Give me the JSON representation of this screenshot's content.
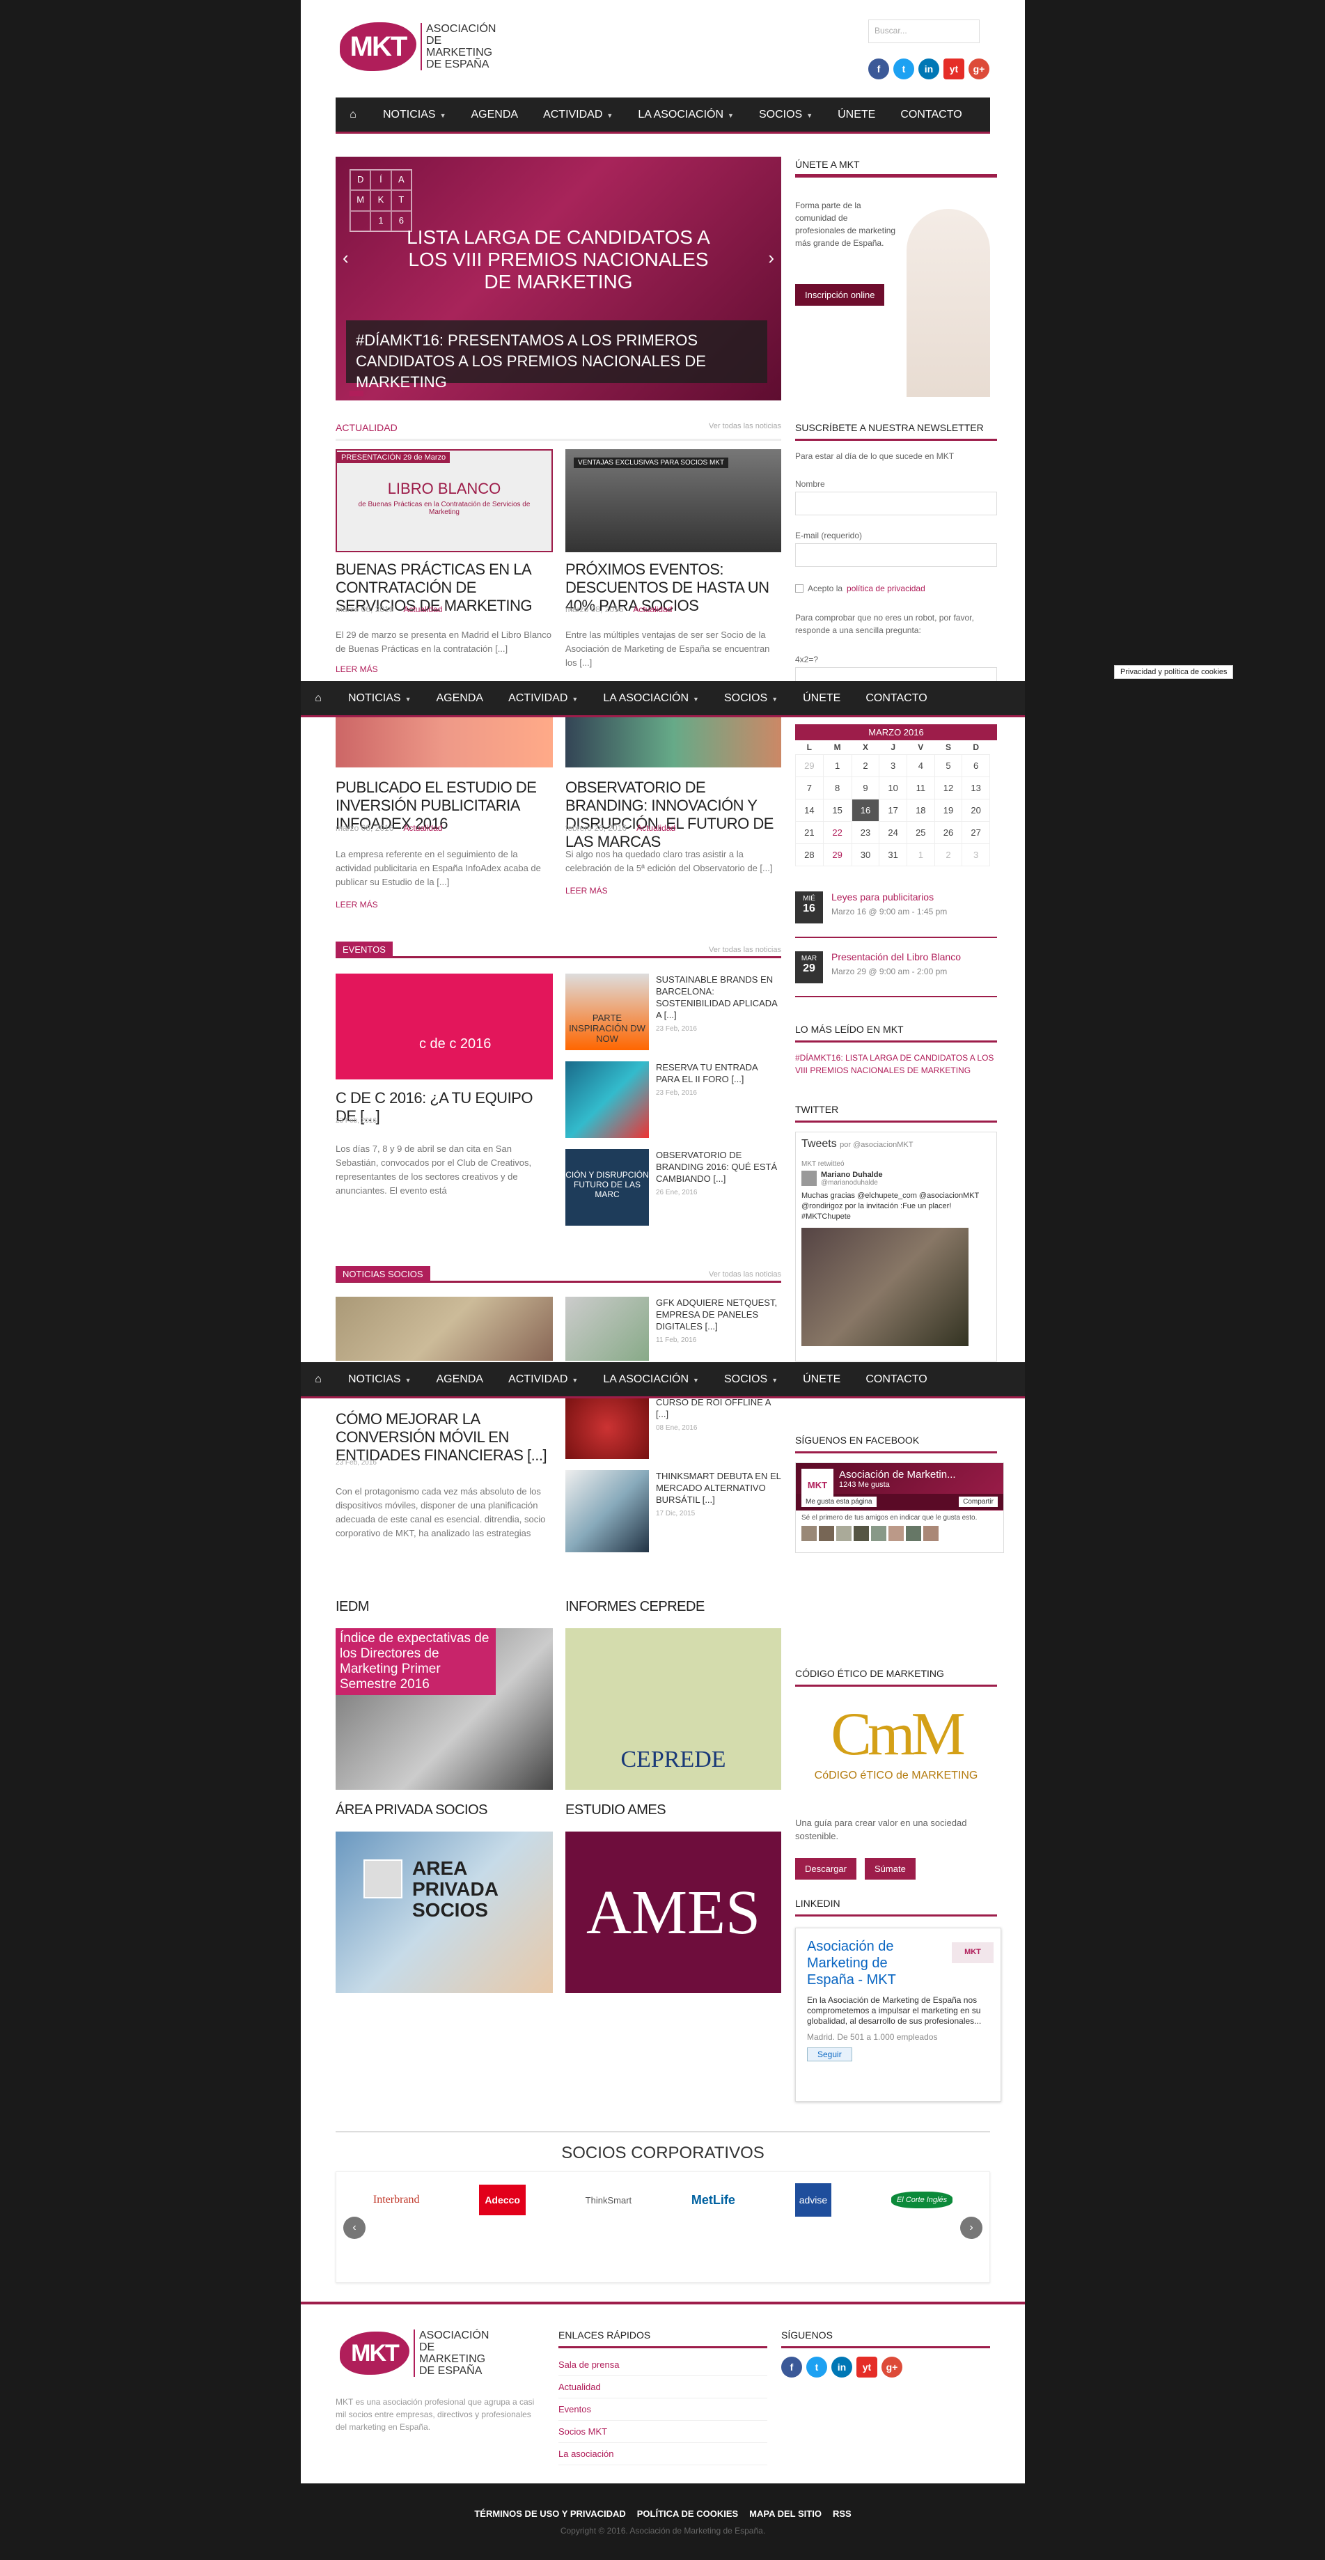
{
  "header": {
    "logo_text": "MKT",
    "logo_sub": "ASOCIACIÓN DE MARKETING DE ESPAÑA",
    "search_placeholder": "Buscar...",
    "social": [
      "f",
      "t",
      "in",
      "yt",
      "g+"
    ]
  },
  "nav": {
    "items": [
      "NOTICIAS",
      "AGENDA",
      "ACTIVIDAD",
      "LA ASOCIACIÓN",
      "SOCIOS",
      "ÚNETE",
      "CONTACTO"
    ]
  },
  "hero": {
    "grid_letters": [
      "D",
      "Í",
      "A",
      "",
      "M",
      "K",
      "T",
      "",
      "1",
      "6"
    ],
    "headline": "LISTA LARGA DE CANDIDATOS A LOS VIII PREMIOS NACIONALES DE MARKETING",
    "caption": "#DÍAMKT16: PRESENTAMOS A LOS PRIMEROS CANDIDATOS A LOS PREMIOS NACIONALES DE MARKETING"
  },
  "join": {
    "title": "ÚNETE A MKT",
    "text": "Forma parte de la comunidad de profesionales de marketing más grande de España.",
    "button": "Inscripción online"
  },
  "actualidad": {
    "title": "ACTUALIDAD",
    "see_all": "Ver todas las noticias",
    "posts": [
      {
        "img_label": "PRESENTACIÓN 29 de Marzo",
        "img_title": "LIBRO BLANCO",
        "img_sub": "de Buenas Prácticas en la Contratación de Servicios de Marketing",
        "title": "BUENAS PRÁCTICAS EN LA CONTRATACIÓN DE SERVICIOS DE MARKETING",
        "date": "marzo 06, 2016",
        "cat": "Actualidad",
        "excerpt": "El 29 de marzo se presenta en Madrid el Libro Blanco de Buenas Prácticas en la contratación [...]",
        "more": "LEER MÁS"
      },
      {
        "img_label": "VENTAJAS EXCLUSIVAS PARA SOCIOS MKT",
        "title": "PRÓXIMOS EVENTOS: DESCUENTOS DE HASTA UN 40% PARA SOCIOS",
        "date": "marzo 08, 2016",
        "cat": "Actualidad",
        "excerpt": "Entre las múltiples ventajas de ser ser Socio de la Asociación de Marketing de España se encuentran los [...]"
      },
      {
        "title": "PUBLICADO EL ESTUDIO DE INVERSIÓN PUBLICITARIA INFOADEX 2016",
        "date": "marzo 08, 2016",
        "cat": "Actualidad",
        "excerpt": "La empresa referente en el seguimiento de la actividad publicitaria en España InfoAdex acaba de publicar su Estudio de la [...]",
        "more": "LEER MÁS"
      },
      {
        "title": "OBSERVATORIO DE BRANDING: INNOVACIÓN Y DISRUPCIÓN, EL FUTURO DE LAS MARCAS",
        "date": "febrero 26, 2016",
        "cat": "Actualidad",
        "excerpt": "Si algo nos ha quedado claro tras asistir a la celebración de la 5ª edición del Observatorio de [...]",
        "more": "LEER MÁS"
      }
    ]
  },
  "newsletter": {
    "title": "SUSCRÍBETE A NUESTRA NEWSLETTER",
    "intro": "Para estar al día de lo que sucede en MKT",
    "name_label": "Nombre",
    "email_label": "E-mail (requerido)",
    "privacy_prefix": "Acepto la",
    "privacy_link": "política de privacidad",
    "robot": "Para comprobar que no eres un robot, por favor, responde a una sencilla pregunta:",
    "question": "4x2=?"
  },
  "privacy_pill": "Privacidad y política de cookies",
  "calendar": {
    "month": "MARZO 2016",
    "days": [
      "L",
      "M",
      "X",
      "J",
      "V",
      "S",
      "D"
    ],
    "rows": [
      [
        "29",
        "1",
        "2",
        "3",
        "4",
        "5",
        "6"
      ],
      [
        "7",
        "8",
        "9",
        "10",
        "11",
        "12",
        "13"
      ],
      [
        "14",
        "15",
        "16",
        "17",
        "18",
        "19",
        "20"
      ],
      [
        "21",
        "22",
        "23",
        "24",
        "25",
        "26",
        "27"
      ],
      [
        "28",
        "29",
        "30",
        "31",
        "1",
        "2",
        "3"
      ]
    ]
  },
  "events": [
    {
      "dow": "MIÉ",
      "day": "16",
      "title": "Leyes para publicitarios",
      "time": "Marzo 16 @ 9:00 am - 1:45 pm"
    },
    {
      "dow": "MAR",
      "day": "29",
      "title": "Presentación del Libro Blanco",
      "time": "Marzo 29 @ 9:00 am - 2:00 pm"
    }
  ],
  "most_read": {
    "title": "LO MÁS LEÍDO EN MKT",
    "link": "#DÍAMKT16: LISTA LARGA DE CANDIDATOS A LOS VIII PREMIOS NACIONALES DE MARKETING"
  },
  "twitter": {
    "title": "TWITTER",
    "tweets_label": "Tweets",
    "by": "por @asociacionMKT",
    "retweeted": "MKT retwitteó",
    "user": "Mariano Duhalde",
    "handle": "@marianoduhalde",
    "text": "Muchas gracias @elchupete_com @asociacionMKT @rondirigoz por la invitación :Fue un placer! #MKTChupete"
  },
  "eventos": {
    "title": "EVENTOS",
    "see_all": "Ver todas las noticias",
    "main_img": "c de c 2016",
    "main_title": "C DE C 2016: ¿A TU EQUIPO DE [...]",
    "main_date": "23 Feb, 2016",
    "main_excerpt": "Los días 7, 8 y 9 de abril se dan cita en San Sebastián, convocados por el Club de Creativos, representantes de los sectores creativos y de anunciantes. El evento está",
    "list": [
      {
        "title": "SUSTAINABLE BRANDS EN BARCELONA: SOSTENIBILIDAD APLICADA A [...]",
        "date": "23 Feb, 2016",
        "img": "PARTE INSPIRACIÓN DW NOW"
      },
      {
        "title": "RESERVA TU ENTRADA PARA EL II FORO [...]",
        "date": "23 Feb, 2016"
      },
      {
        "title": "OBSERVATORIO DE BRANDING 2016: QUÉ ESTÁ CAMBIANDO [...]",
        "date": "26 Ene, 2016",
        "img": "CIÓN Y DISRUPCIÓN FUTURO DE LAS MARC"
      }
    ]
  },
  "noticias_socios": {
    "title": "NOTICIAS SOCIOS",
    "see_all": "Ver todas las noticias",
    "main_title": "CÓMO MEJORAR LA CONVERSIÓN MÓVIL EN ENTIDADES FINANCIERAS [...]",
    "main_date": "23 Feb, 2016",
    "main_excerpt": "Con el protagonismo cada vez más absoluto de los dispositivos móviles, disponer de una planificación adecuada de este canal es esencial. ditrendia, socio corporativo de MKT, ha analizado las estrategias",
    "list": [
      {
        "title": "GFK ADQUIERE NETQUEST, EMPRESA DE PANELES DIGITALES [...]",
        "date": "11 Feb, 2016"
      },
      {
        "title": "CURSO DE ROI OFFLINE A [...]",
        "date": "08 Ene, 2016"
      },
      {
        "title": "THINKSMART DEBUTA EN EL MERCADO ALTERNATIVO BURSÁTIL [...]",
        "date": "17 Dic, 2015"
      }
    ]
  },
  "facebook": {
    "title": "SÍGUENOS EN FACEBOOK",
    "page": "Asociación de Marketin...",
    "likes": "1243 Me gusta",
    "like_btn": "Me gusta esta página",
    "share_btn": "Compartir",
    "friends": "Sé el primero de tus amigos en indicar que le gusta esto."
  },
  "blocks": [
    {
      "title": "IEDM",
      "img": "Índice de expectativas de los Directores de Marketing Primer Semestre 2016"
    },
    {
      "title": "INFORMES CEPREDE",
      "img": "CEPREDE"
    },
    {
      "title": "ÁREA PRIVADA SOCIOS",
      "img": "AREA PRIVADA SOCIOS"
    },
    {
      "title": "ESTUDIO AMES",
      "img": "AMES"
    }
  ],
  "codigo": {
    "title": "CÓDIGO ÉTICO DE MARKETING",
    "logo": "CmM",
    "logo_sub": "CóDIGO éTICO de MARKETING",
    "text": "Una guía para crear valor en una sociedad sostenible.",
    "btn1": "Descargar",
    "btn2": "Súmate"
  },
  "linkedin": {
    "title": "LINKEDIN",
    "company": "Asociación de Marketing de España - MKT",
    "desc": "En la Asociación de Marketing de España nos comprometemos a impulsar el marketing en su globalidad, al desarrollo de sus profesionales...",
    "loc": "Madrid. De 501 a 1.000 empleados",
    "follow": "Seguir"
  },
  "sponsors": {
    "title": "SOCIOS CORPORATIVOS",
    "logos": [
      "Interbrand",
      "Adecco",
      "ThinkSmart",
      "MetLife",
      "advise",
      "El Corte Inglés"
    ]
  },
  "footer": {
    "about": "MKT es una asociación profesional que agrupa a casi mil socios entre empresas, directivos y profesionales del marketing en España.",
    "links_title": "ENLACES RÁPIDOS",
    "links": [
      "Sala de prensa",
      "Actualidad",
      "Eventos",
      "Socios MKT",
      "La asociación"
    ],
    "follow_title": "SÍGUENOS",
    "bottom_links": [
      "TÉRMINOS DE USO Y PRIVACIDAD",
      "POLÍTICA DE COOKIES",
      "MAPA DEL SITIO",
      "RSS"
    ],
    "copyright": "Copyright © 2016. Asociación de Marketing de España."
  }
}
